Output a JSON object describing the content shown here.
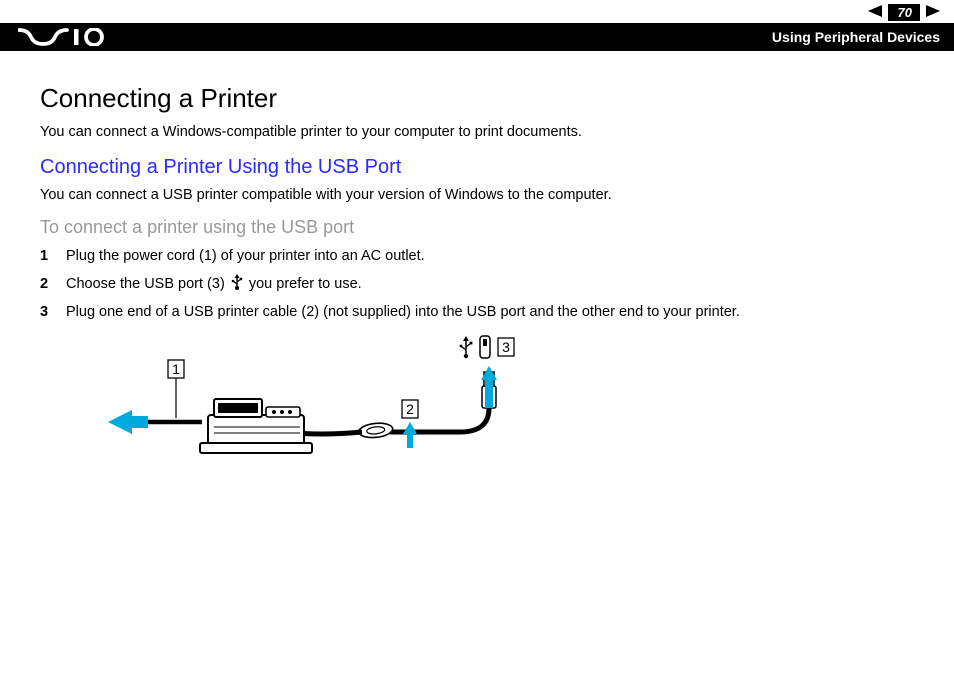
{
  "nav": {
    "page_number": "70",
    "section_label": "Using Peripheral Devices"
  },
  "content": {
    "title": "Connecting a Printer",
    "intro": "You can connect a Windows-compatible printer to your computer to print documents.",
    "subtitle": "Connecting a Printer Using the USB Port",
    "sub_intro": "You can connect a USB printer compatible with your version of Windows to the computer.",
    "procedure_heading": "To connect a printer using the USB port",
    "steps": [
      {
        "n": "1",
        "text": "Plug the power cord (1) of your printer into an AC outlet."
      },
      {
        "n": "2",
        "text_a": "Choose the USB port (3) ",
        "text_b": " you prefer to use."
      },
      {
        "n": "3",
        "text": "Plug one end of a USB printer cable (2) (not supplied) into the USB port and the other end to your printer."
      }
    ],
    "diagram_labels": {
      "one": "1",
      "two": "2",
      "three": "3"
    }
  }
}
